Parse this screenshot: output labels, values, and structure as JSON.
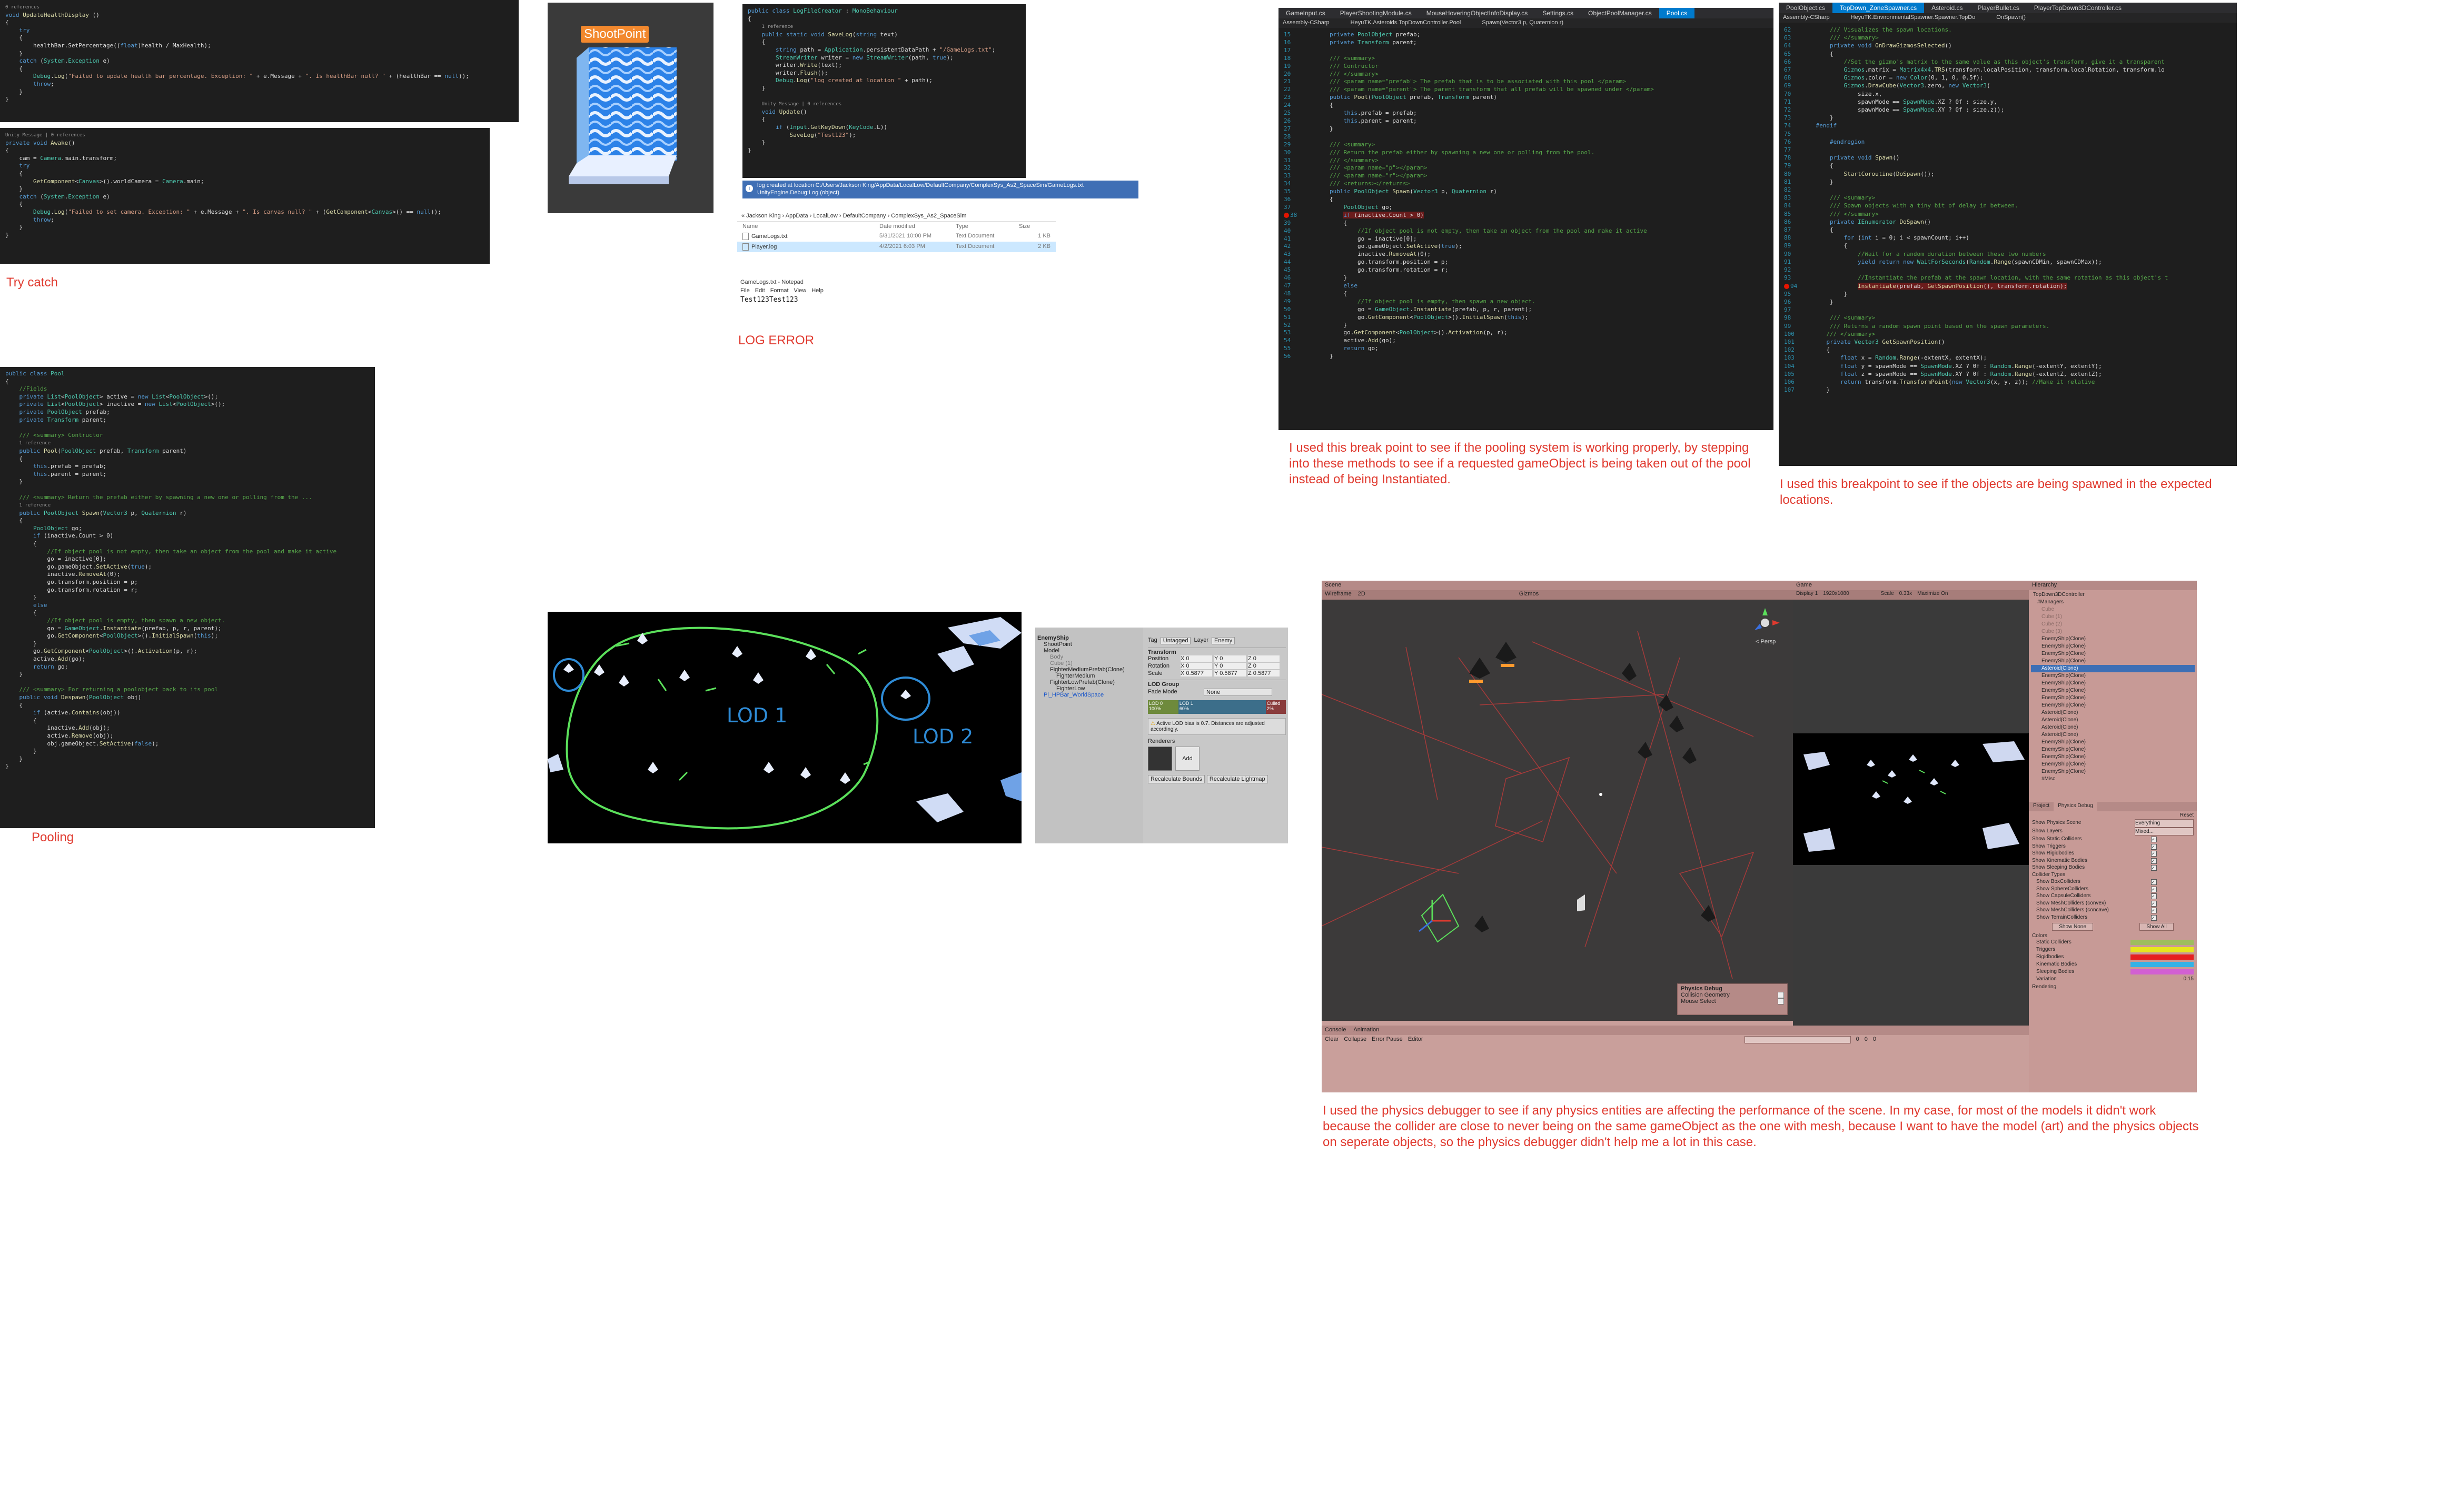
{
  "captions": {
    "try_catch": "Try catch",
    "log_error": "LOG ERROR",
    "pooling": "Pooling",
    "breakpoint_pool": "I used this break point to see if the pooling system is working properly, by stepping into these methods to see if a requested gameObject is being taken out of the pool instead of being Instantiated.",
    "breakpoint_spawn": "I used this breakpoint to see if the objects are being spawned in the expected locations.",
    "physics_debugger": "I used the physics debugger to see if any physics entities are affecting the performance of the scene. In my case, for most of the models it didn't work because the collider are close to never being on the same gameObject as the one with mesh, because I want to have the model (art) and the physics objects on seperate objects, so the physics debugger didn't help me a lot in this case."
  },
  "shoot_point_label": "ShootPoint",
  "lod_labels": [
    "LOD 1",
    "LOD 2"
  ],
  "log_path_tooltip": "log created at location C:/Users/Jackson King/AppData/LocalLow/DefaultCompany/ComplexSys_As2_SpaceSim/GameLogs.txt UnityEngine.Debug:Log (object)",
  "explorer": {
    "breadcrumb": "« Jackson King › AppData › LocalLow › DefaultCompany › ComplexSys_As2_SpaceSim",
    "columns": [
      "Name",
      "Date modified",
      "Type",
      "Size"
    ],
    "rows": [
      {
        "name": "GameLogs.txt",
        "date": "5/31/2021 10:00 PM",
        "type": "Text Document",
        "size": "1 KB"
      },
      {
        "name": "Player.log",
        "date": "4/2/2021 6:03 PM",
        "type": "Text Document",
        "size": "2 KB"
      }
    ]
  },
  "notepad": {
    "title": "GameLogs.txt - Notepad",
    "menu": [
      "File",
      "Edit",
      "Format",
      "View",
      "Help"
    ],
    "content": "Test123Test123"
  },
  "vs_tabs_pool": [
    "GameInput.cs",
    "PlayerShootingModule.cs",
    "MouseHoveringObjectInfoDisplay.cs",
    "Settings.cs",
    "ObjectPoolManager.cs",
    "Pool.cs"
  ],
  "vs_sub_pool": [
    "Assembly-CSharp",
    "HeyuTK.Asteroids.TopDownController.Pool",
    "Spawn(Vector3 p, Quaternion r)"
  ],
  "vs_tabs_spawn": [
    "PoolObject.cs",
    "TopDown_ZoneSpawner.cs",
    "Asteroid.cs",
    "PlayerBullet.cs",
    "PlayerTopDown3DController.cs"
  ],
  "vs_sub_spawn": [
    "Assembly-CSharp",
    "HeyuTK.EnvironmentalSpawner.Spawner.TopDo",
    "OnSpawn()"
  ],
  "unity_hierarchy": {
    "title": "Hierarchy",
    "items": [
      "TopDown3DController",
      "#Managers",
      "Cube",
      "Cube (1)",
      "Cube (2)",
      "Cube (3)",
      "EnemyShip(Clone)",
      "EnemyShip(Clone)",
      "EnemyShip(Clone)",
      "EnemyShip(Clone)",
      "Asteroid(Clone)",
      "EnemyShip(Clone)",
      "EnemyShip(Clone)",
      "EnemyShip(Clone)",
      "EnemyShip(Clone)",
      "EnemyShip(Clone)",
      "Asteroid(Clone)",
      "Asteroid(Clone)",
      "Asteroid(Clone)",
      "Asteroid(Clone)",
      "EnemyShip(Clone)",
      "EnemyShip(Clone)",
      "EnemyShip(Clone)",
      "EnemyShip(Clone)",
      "EnemyShip(Clone)",
      "#Misc"
    ]
  },
  "physics_debug": {
    "tabs": [
      "Project",
      "Physics Debug"
    ],
    "reset": "Reset",
    "rows": [
      "Show Physics Scene",
      "Show Layers",
      "Show Static Colliders",
      "Show Triggers",
      "Show Rigidbodies",
      "Show Kinematic Bodies",
      "Show Sleeping Bodies",
      "Collider Types",
      "Show BoxColliders",
      "Show SphereColliders",
      "Show CapsuleColliders",
      "Show MeshColliders (convex)",
      "Show MeshColliders (concave)",
      "Show TerrainColliders"
    ],
    "values": [
      "Everything",
      "Mixed..."
    ],
    "buttons": [
      "Show None",
      "Show All"
    ],
    "colors_title": "Colors",
    "color_rows": [
      "Static Colliders",
      "Triggers",
      "Rigidbodies",
      "Kinematic Bodies",
      "Sleeping Bodies",
      "Variation"
    ],
    "swatches": [
      "#9ebd5e",
      "#e6e61e",
      "#e62020",
      "#33b2e6",
      "#d260d2"
    ],
    "variation_value": "0.15",
    "rendering": "Rendering"
  },
  "unity_scene": {
    "scene_tab": "Scene",
    "game_tab": "Game",
    "shading": "Wireframe",
    "mode": "2D",
    "gizmos": "Gizmos",
    "display": "Display 1",
    "resolution": "1920x1080",
    "scale": "Scale",
    "scale_value": "0.33x",
    "maximize": "Maximize On",
    "persp": "< Persp",
    "overlay_title": "Physics Debug",
    "overlay_rows": [
      "Collision Geometry",
      "Mouse Select"
    ],
    "console_tabs": [
      "Console",
      "Animation"
    ],
    "console_buttons": [
      "Clear",
      "Collapse",
      "Error Pause",
      "Editor"
    ],
    "counts": [
      "0",
      "0",
      "0"
    ]
  },
  "inspector": {
    "hier_items": [
      "EnemyShip",
      "ShootPoint",
      "Model",
      "Body",
      "Cube (1)",
      "FighterMediumPrefab(Clone)",
      "FighterMedium",
      "FighterLowPrefab(Clone)",
      "FighterLow",
      "Pl_HPBar_WorldSpace"
    ],
    "tag_label": "Tag",
    "tag_value": "Untagged",
    "layer_label": "Layer",
    "layer_value": "Enemy",
    "transform_title": "Transform",
    "position": "Position",
    "rotation": "Rotation",
    "scale": "Scale",
    "pos_values": [
      "X 0",
      "Y 0",
      "Z 0"
    ],
    "rot_values": [
      "X 0",
      "Y 0",
      "Z 0"
    ],
    "scale_values": [
      "X 0.5877",
      "Y 0.5877",
      "Z 0.5877"
    ],
    "lod_group": "LOD Group",
    "fade_mode": "Fade Mode",
    "fade_value": "None",
    "lod0": "LOD 0\n100%",
    "lod1": "LOD 1\n60%",
    "culled": "Culled\n2%",
    "warning": "Active LOD bias is 0.7. Distances are adjusted accordingly.",
    "renderers": "Renderers",
    "add": "Add",
    "recalc_bounds": "Recalculate Bounds",
    "recalc_lightmap": "Recalculate Lightmap"
  }
}
